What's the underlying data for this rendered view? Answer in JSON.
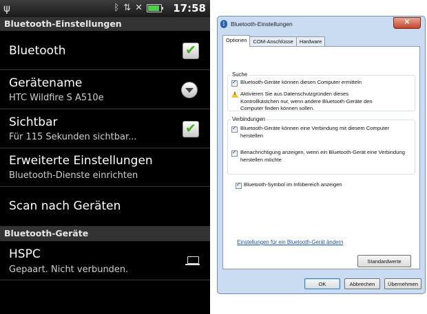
{
  "phone": {
    "status": {
      "left_icon": "usb-icon",
      "right_icons": [
        "bluetooth-icon",
        "sync-icon",
        "signal-off-icon",
        "battery-icon"
      ],
      "time": "17:58"
    },
    "section_settings": "Bluetooth-Einstellungen",
    "items": [
      {
        "title": "Bluetooth",
        "subtitle": "",
        "control": "checkbox-checked"
      },
      {
        "title": "Gerätename",
        "subtitle": "HTC Wildfire S A510e",
        "control": "dropdown"
      },
      {
        "title": "Sichtbar",
        "subtitle": "Für 115 Sekunden sichtbar...",
        "control": "checkbox-checked"
      },
      {
        "title": "Erweiterte Einstellungen",
        "subtitle": "Bluetooth-Dienste einrichten",
        "control": ""
      },
      {
        "title": "Scan nach Geräten",
        "subtitle": "",
        "control": ""
      }
    ],
    "section_devices": "Bluetooth-Geräte",
    "device": {
      "title": "HSPC",
      "subtitle": "Gepaart. Nicht verbunden.",
      "icon": "laptop-icon"
    }
  },
  "dialog": {
    "title": "Bluetooth-Einstellungen",
    "close_glyph": "✕",
    "tabs": [
      "Optionen",
      "COM-Anschlüsse",
      "Hardware"
    ],
    "search_group": {
      "label": "Suche",
      "option": "Bluetooth-Geräte können diesen Computer ermitteln",
      "warning": "Aktivieren Sie aus Datenschutzgründen dieses Kontrollkästchen nur, wenn andere Bluetooth-Geräte den Computer finden können sollen."
    },
    "connections_group": {
      "label": "Verbindungen",
      "option1": "Bluetooth-Geräte können eine Verbindung mit diesem Computer herstellen",
      "option2": "Benachrichtigung anzeigen, wenn ein Bluetooth-Gerät eine Verbindung herstellen möchte"
    },
    "tray_option": "Bluetooth-Symbol im Infobereich anzeigen",
    "link": "Einstellungen für ein Bluetooth-Gerät ändern",
    "defaults_button": "Standardwerte",
    "ok_button": "OK",
    "cancel_button": "Abbrechen",
    "apply_button": "Übernehmen"
  }
}
